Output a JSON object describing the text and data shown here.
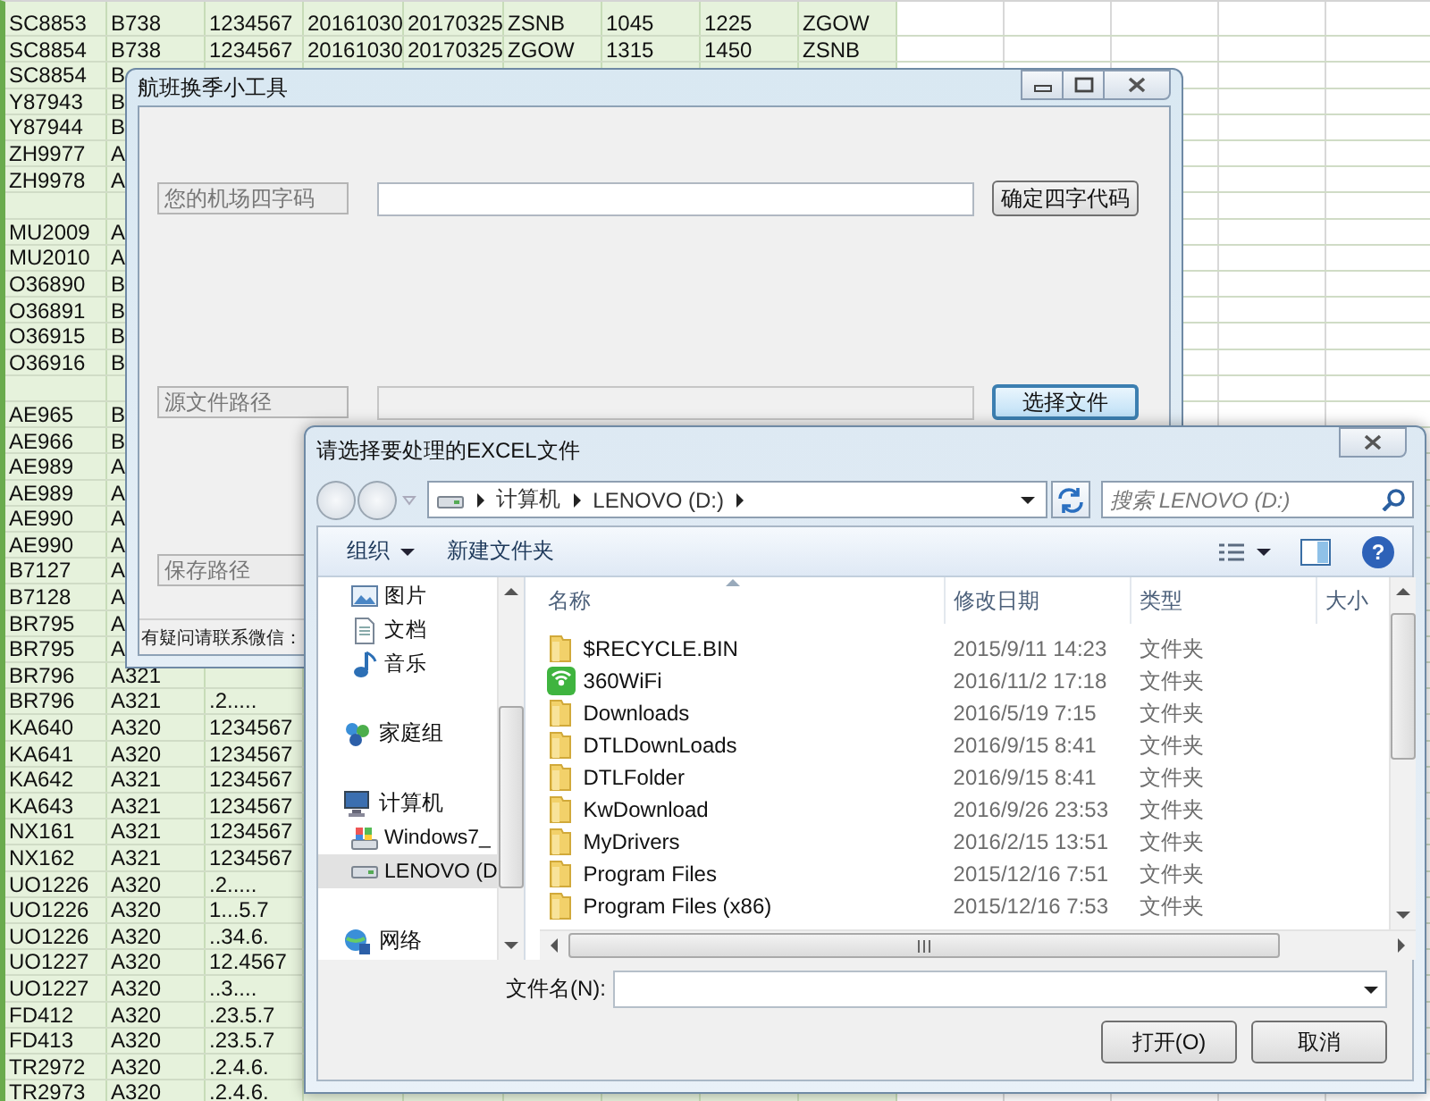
{
  "spreadsheet": {
    "rows": [
      {
        "cells": [
          "SC8853",
          "B738",
          "1234567",
          "20161030",
          "20170325",
          "ZSNB",
          "1045",
          "1225",
          "ZGOW"
        ]
      },
      {
        "cells": [
          "SC8854",
          "B738",
          "1234567",
          "20161030",
          "20170325",
          "ZGOW",
          "1315",
          "1450",
          "ZSNB"
        ]
      },
      {
        "cells": [
          "SC8854",
          "B"
        ]
      },
      {
        "cells": [
          "Y87943",
          "B"
        ]
      },
      {
        "cells": [
          "Y87944",
          "B"
        ]
      },
      {
        "cells": [
          "ZH9977",
          "A"
        ]
      },
      {
        "cells": [
          "ZH9978",
          "A"
        ]
      },
      {
        "cells": []
      },
      {
        "cells": [
          "MU2009",
          "A"
        ]
      },
      {
        "cells": [
          "MU2010",
          "A"
        ]
      },
      {
        "cells": [
          "O36890",
          "B"
        ]
      },
      {
        "cells": [
          "O36891",
          "B"
        ]
      },
      {
        "cells": [
          "O36915",
          "B"
        ]
      },
      {
        "cells": [
          "O36916",
          "B"
        ]
      },
      {
        "cells": []
      },
      {
        "cells": [
          "AE965",
          "B"
        ]
      },
      {
        "cells": [
          "AE966",
          "B"
        ]
      },
      {
        "cells": [
          "AE989",
          "A"
        ]
      },
      {
        "cells": [
          "AE989",
          "A"
        ]
      },
      {
        "cells": [
          "AE990",
          "A"
        ]
      },
      {
        "cells": [
          "AE990",
          "A"
        ]
      },
      {
        "cells": [
          "B7127",
          "A"
        ]
      },
      {
        "cells": [
          "B7128",
          "A"
        ]
      },
      {
        "cells": [
          "BR795",
          "A"
        ]
      },
      {
        "cells": [
          "BR795",
          "A"
        ]
      },
      {
        "cells": [
          "BR796",
          "A321"
        ]
      },
      {
        "cells": [
          "BR796",
          "A321",
          ".2....."
        ]
      },
      {
        "cells": [
          "KA640",
          "A320",
          "1234567"
        ]
      },
      {
        "cells": [
          "KA641",
          "A320",
          "1234567"
        ]
      },
      {
        "cells": [
          "KA642",
          "A321",
          "1234567"
        ]
      },
      {
        "cells": [
          "KA643",
          "A321",
          "1234567"
        ]
      },
      {
        "cells": [
          "NX161",
          "A321",
          "1234567"
        ]
      },
      {
        "cells": [
          "NX162",
          "A321",
          "1234567"
        ]
      },
      {
        "cells": [
          "UO1226",
          "A320",
          ".2....."
        ]
      },
      {
        "cells": [
          "UO1226",
          "A320",
          "1...5.7"
        ]
      },
      {
        "cells": [
          "UO1226",
          "A320",
          "..34.6."
        ]
      },
      {
        "cells": [
          "UO1227",
          "A320",
          "12.4567"
        ]
      },
      {
        "cells": [
          "UO1227",
          "A320",
          "..3...."
        ]
      },
      {
        "cells": [
          "FD412",
          "A320",
          ".23.5.7"
        ]
      },
      {
        "cells": [
          "FD413",
          "A320",
          ".23.5.7"
        ]
      },
      {
        "cells": [
          "TR2972",
          "A320",
          ".2.4.6."
        ]
      },
      {
        "cells": [
          "TR2973",
          "A320",
          ".2.4.6."
        ]
      }
    ]
  },
  "tool_window": {
    "title": "航班换季小工具",
    "fields": [
      {
        "label": "您的机场四字码",
        "input_disabled": false,
        "button": "确定四字代码",
        "button_focused": false
      },
      {
        "label": "源文件路径",
        "input_disabled": true,
        "button": "选择文件",
        "button_focused": true
      },
      {
        "label": "保存路径"
      }
    ],
    "status_text": "有疑问请联系微信："
  },
  "file_dialog": {
    "title": "请选择要处理的EXCEL文件",
    "breadcrumbs": [
      "计算机",
      "LENOVO (D:)"
    ],
    "search": {
      "placeholder": "搜索 LENOVO (D:)"
    },
    "toolbar": {
      "organize": "组织",
      "new_folder": "新建文件夹",
      "help": "?"
    },
    "nav_pane": {
      "library_items": [
        {
          "label": "图片",
          "kind": "pictures",
          "selected": false
        },
        {
          "label": "文档",
          "kind": "documents",
          "selected": false
        },
        {
          "label": "音乐",
          "kind": "music",
          "selected": false
        }
      ],
      "items": [
        {
          "label": "家庭组",
          "kind": "homegroup",
          "selected": false
        },
        {
          "label": "计算机",
          "kind": "computer",
          "selected": false,
          "children": [
            {
              "label": "Windows7_",
              "kind": "system-drive",
              "selected": false
            },
            {
              "label": "LENOVO (D",
              "kind": "drive",
              "selected": true
            }
          ]
        },
        {
          "label": "网络",
          "kind": "network",
          "selected": false
        }
      ]
    },
    "columns": [
      "名称",
      "修改日期",
      "类型",
      "大小"
    ],
    "files": [
      {
        "name": "$RECYCLE.BIN",
        "modified": "2015/9/11 14:23",
        "type": "文件夹",
        "kind": "folder"
      },
      {
        "name": "360WiFi",
        "modified": "2016/11/2 17:18",
        "type": "文件夹",
        "kind": "app-folder"
      },
      {
        "name": "Downloads",
        "modified": "2016/5/19 7:15",
        "type": "文件夹",
        "kind": "folder"
      },
      {
        "name": "DTLDownLoads",
        "modified": "2016/9/15 8:41",
        "type": "文件夹",
        "kind": "folder"
      },
      {
        "name": "DTLFolder",
        "modified": "2016/9/15 8:41",
        "type": "文件夹",
        "kind": "folder"
      },
      {
        "name": "KwDownload",
        "modified": "2016/9/26 23:53",
        "type": "文件夹",
        "kind": "folder"
      },
      {
        "name": "MyDrivers",
        "modified": "2016/2/15 13:51",
        "type": "文件夹",
        "kind": "folder"
      },
      {
        "name": "Program Files",
        "modified": "2015/12/16 7:51",
        "type": "文件夹",
        "kind": "folder"
      },
      {
        "name": "Program Files (x86)",
        "modified": "2015/12/16 7:53",
        "type": "文件夹",
        "kind": "folder"
      }
    ],
    "filename_label": "文件名(N):",
    "buttons": [
      "打开(O)",
      "取消"
    ]
  }
}
